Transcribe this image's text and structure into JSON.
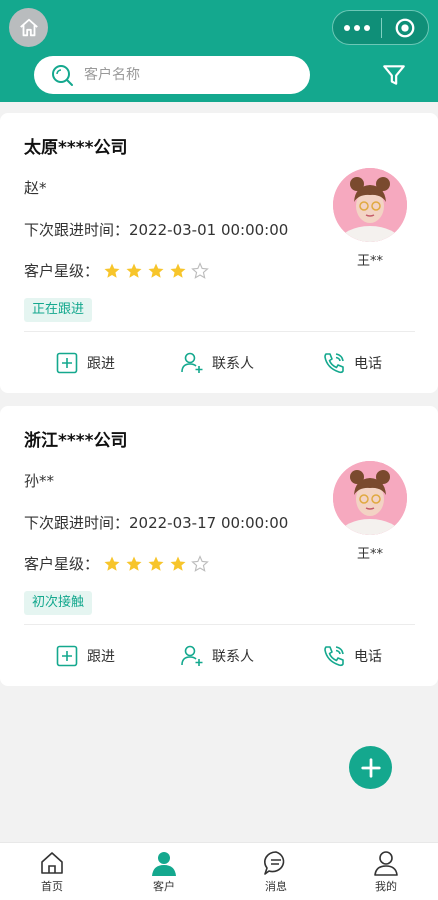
{
  "search": {
    "placeholder": "客户名称"
  },
  "colors": {
    "accent": "#14a88e",
    "star_on": "#f7c52b",
    "star_off": "#bcbcbc",
    "avatar_bg": "#f6a9bf"
  },
  "icons": {
    "home": "home-icon",
    "more": "more-dots-icon",
    "close": "target-icon",
    "search": "search-icon",
    "filter": "filter-icon",
    "add": "plus-icon"
  },
  "customers": [
    {
      "name": "太原****公司",
      "contact": "赵*",
      "next_followup": "下次跟进时间：2022-03-01 00:00:00",
      "rating_label": "客户星级：",
      "rating": 4,
      "rating_max": 5,
      "status": "正在跟进",
      "owner": "王**"
    },
    {
      "name": "浙江****公司",
      "contact": "孙**",
      "next_followup": "下次跟进时间：2022-03-17 00:00:00",
      "rating_label": "客户星级：",
      "rating": 4,
      "rating_max": 5,
      "status": "初次接触",
      "owner": "王**"
    }
  ],
  "actions": {
    "followup": "跟进",
    "contacts": "联系人",
    "phone": "电话"
  },
  "tabs": [
    {
      "label": "首页",
      "icon": "home-icon"
    },
    {
      "label": "客户",
      "icon": "user-icon",
      "active": true
    },
    {
      "label": "消息",
      "icon": "message-icon"
    },
    {
      "label": "我的",
      "icon": "profile-icon"
    }
  ]
}
